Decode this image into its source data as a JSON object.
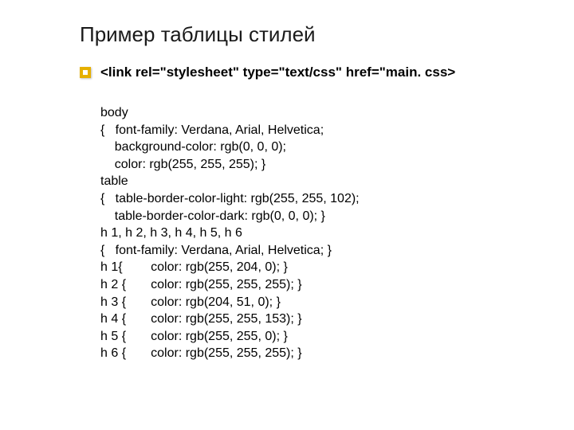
{
  "title": "Пример таблицы стилей",
  "link_line": "<link rel=\"stylesheet\" type=\"text/css\" href=\"main. css>",
  "code": "body\n{   font-family: Verdana, Arial, Helvetica;\n    background-color: rgb(0, 0, 0);\n    color: rgb(255, 255, 255); }\ntable\n{   table-border-color-light: rgb(255, 255, 102);\n    table-border-color-dark: rgb(0, 0, 0); }\nh 1, h 2, h 3, h 4, h 5, h 6\n{   font-family: Verdana, Arial, Helvetica; }\nh 1{        color: rgb(255, 204, 0); }\nh 2 {       color: rgb(255, 255, 255); }\nh 3 {       color: rgb(204, 51, 0); }\nh 4 {       color: rgb(255, 255, 153); }\nh 5 {       color: rgb(255, 255, 0); }\nh 6 {       color: rgb(255, 255, 255); }"
}
